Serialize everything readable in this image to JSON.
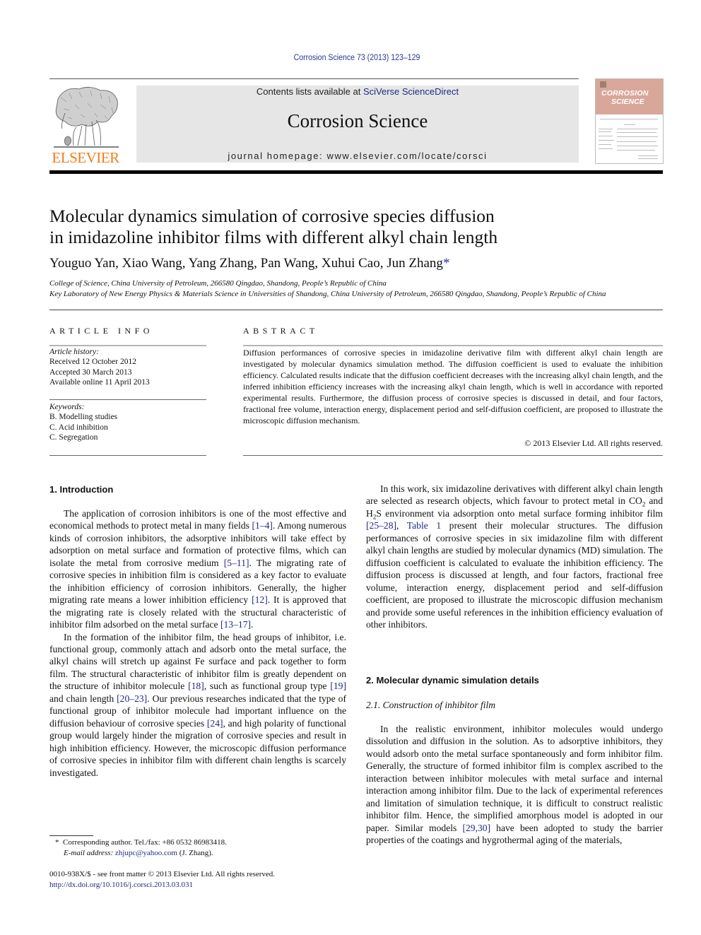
{
  "journal_citation": "Corrosion Science 73 (2013) 123–129",
  "header": {
    "contents_prefix": "Contents lists available at ",
    "contents_link": "SciVerse ScienceDirect",
    "journal_title": "Corrosion Science",
    "homepage": "journal homepage: www.elsevier.com/locate/corsci",
    "publisher_logo_text": "ELSEVIER",
    "cover_title_line1": "CORROSION",
    "cover_title_line2": "SCIENCE"
  },
  "article": {
    "title_line1": "Molecular dynamics simulation of corrosive species diffusion",
    "title_line2": "in imidazoline inhibitor films with different alkyl chain length",
    "authors": "Youguo Yan, Xiao Wang, Yang Zhang, Pan Wang, Xuhui Cao, Jun Zhang",
    "corresponding_marker": "*",
    "affiliations": [
      "College of Science, China University of Petroleum, 266580 Qingdao, Shandong, People’s Republic of China",
      "Key Laboratory of New Energy Physics & Materials Science in Universities of Shandong, China University of Petroleum, 266580 Qingdao, Shandong, People’s Republic of China"
    ]
  },
  "article_info": {
    "heading": "ARTICLE INFO",
    "history_label": "Article history:",
    "history": [
      "Received 12 October 2012",
      "Accepted 30 March 2013",
      "Available online 11 April 2013"
    ],
    "keywords_label": "Keywords:",
    "keywords": [
      "B. Modelling studies",
      "C. Acid inhibition",
      "C. Segregation"
    ]
  },
  "abstract": {
    "heading": "ABSTRACT",
    "text": "Diffusion performances of corrosive species in imidazoline derivative film with different alkyl chain length are investigated by molecular dynamics simulation method. The diffusion coefficient is used to evaluate the inhibition efficiency. Calculated results indicate that the diffusion coefficient decreases with the increasing alkyl chain length, and the inferred inhibition efficiency increases with the increasing alkyl chain length, which is well in accordance with reported experimental results. Furthermore, the diffusion process of corrosive species is discussed in detail, and four factors, fractional free volume, interaction energy, displacement period and self-diffusion coefficient, are proposed to illustrate the microscopic diffusion mechanism.",
    "copyright": "© 2013 Elsevier Ltd. All rights reserved."
  },
  "sections": {
    "intro_heading": "1. Introduction",
    "intro_p1": {
      "t1": "The application of corrosion inhibitors is one of the most effective and economical methods to protect metal in many fields ",
      "r1": "[1–4]",
      "t2": ". Among numerous kinds of corrosion inhibitors, the adsorptive inhibitors will take effect by adsorption on metal surface and formation of protective films, which can isolate the metal from corrosive medium ",
      "r2": "[5–11]",
      "t3": ". The migrating rate of corrosive species in inhibition film is considered as a key factor to evaluate the inhibition efficiency of corrosion inhibitors. Generally, the higher migrating rate means a lower inhibition efficiency ",
      "r3": "[12]",
      "t4": ". It is approved that the migrating rate is closely related with the structural characteristic of inhibitor film adsorbed on the metal surface ",
      "r4": "[13–17]",
      "t5": "."
    },
    "intro_p2": {
      "t1": "In the formation of the inhibitor film, the head groups of inhibitor, i.e. functional group, commonly attach and adsorb onto the metal surface, the alkyl chains will stretch up against Fe surface and pack together to form film. The structural characteristic of inhibitor film is greatly dependent on the structure of inhibitor molecule ",
      "r1": "[18]",
      "t2": ", such as functional group type ",
      "r2": "[19]",
      "t3": " and chain length ",
      "r3": "[20–23]",
      "t4": ". Our previous researches indicated that the type of functional group of inhibitor molecule had important influence on the diffusion behaviour of corrosive species ",
      "r4": "[24]",
      "t5": ", and high polarity of functional group would largely hinder the migration of corrosive species and result in high inhibition efficiency. However, the microscopic diffusion performance of corrosive species in inhibitor film with different chain lengths is scarcely investigated."
    },
    "intro_p3": {
      "t1": "In this work, six imidazoline derivatives with different alkyl chain length are selected as research objects, which favour to protect metal in CO",
      "sub1": "2",
      "t2": " and H",
      "sub2": "2",
      "t3": "S environment via adsorption onto metal surface forming inhibitor film ",
      "r1": "[25–28]",
      "t4": ", ",
      "r2": "Table 1",
      "t5": " present their molecular structures. The diffusion performances of corrosive species in six imidazoline film with different alkyl chain lengths are studied by molecular dynamics (MD) simulation. The diffusion coefficient is calculated to evaluate the inhibition efficiency. The diffusion process is discussed at length, and four factors, fractional free volume, interaction energy, displacement period and self-diffusion coefficient, are proposed to illustrate the microscopic diffusion mechanism and provide some useful references in the inhibition efficiency evaluation of other inhibitors."
    },
    "sec2_heading": "2. Molecular dynamic simulation details",
    "sec21_heading": "2.1. Construction of inhibitor film",
    "sec21_p1": {
      "t1": "In the realistic environment, inhibitor molecules would undergo dissolution and diffusion in the solution. As to adsorptive inhibitors, they would adsorb onto the metal surface spontaneously and form inhibitor film. Generally, the structure of formed inhibitor film is complex ascribed to the interaction between inhibitor molecules with metal surface and internal interaction among inhibitor film. Due to the lack of experimental references and limitation of simulation technique, it is difficult to construct realistic inhibitor film. Hence, the simplified amorphous model is adopted in our paper. Similar models ",
      "r1": "[29,30]",
      "t2": " have been adopted to study the barrier properties of the coatings and hygrothermal aging of the materials,"
    }
  },
  "footnotes": {
    "corresponding_marker": "*",
    "corresponding": "Corresponding author. Tel./fax: +86 0532 86983418.",
    "email_label": "E-mail address:",
    "email": "zhjupc@yahoo.com",
    "email_suffix": " (J. Zhang).",
    "issn": "0010-938X/$ - see front matter © 2013 Elsevier Ltd. All rights reserved.",
    "doi": "http://dx.doi.org/10.1016/j.corsci.2013.03.031"
  },
  "colors": {
    "link": "#1f2a80",
    "elsevier_orange": "#f07d1a",
    "banner_gray": "#e6e6e6",
    "cover_pink": "#d9a79a"
  }
}
